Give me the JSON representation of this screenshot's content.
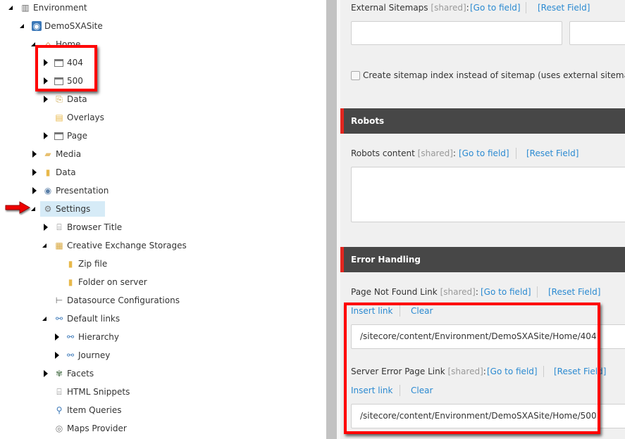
{
  "tree": {
    "items": [
      {
        "label": "Environment",
        "level": 0,
        "state": "expanded",
        "icon": "building-icon"
      },
      {
        "label": "DemoSXASite",
        "level": 1,
        "state": "expanded",
        "icon": "globe-icon"
      },
      {
        "label": "Home",
        "level": 2,
        "state": "expanded",
        "icon": "home-icon"
      },
      {
        "label": "404",
        "level": 3,
        "state": "collapsed",
        "icon": "page-icon"
      },
      {
        "label": "500",
        "level": 3,
        "state": "collapsed",
        "icon": "page-icon"
      },
      {
        "label": "Data",
        "level": 3,
        "state": "collapsed",
        "icon": "data-page-icon"
      },
      {
        "label": "Overlays",
        "level": 3,
        "state": "none",
        "icon": "folder-window-icon"
      },
      {
        "label": "Page",
        "level": 3,
        "state": "collapsed",
        "icon": "page-icon"
      },
      {
        "label": "Media",
        "level": 2,
        "state": "collapsed",
        "icon": "media-folder-icon"
      },
      {
        "label": "Data",
        "level": 2,
        "state": "collapsed",
        "icon": "data-icon"
      },
      {
        "label": "Presentation",
        "level": 2,
        "state": "collapsed",
        "icon": "eye-icon"
      },
      {
        "label": "Settings",
        "level": 2,
        "state": "expanded",
        "icon": "gears-icon",
        "selected": true
      },
      {
        "label": "Browser Title",
        "level": 3,
        "state": "collapsed",
        "icon": "code-page-icon"
      },
      {
        "label": "Creative Exchange Storages",
        "level": 3,
        "state": "expanded",
        "icon": "storage-icon"
      },
      {
        "label": "Zip file",
        "level": 4,
        "state": "none",
        "icon": "zip-icon"
      },
      {
        "label": "Folder on server",
        "level": 4,
        "state": "none",
        "icon": "zip-icon"
      },
      {
        "label": "Datasource Configurations",
        "level": 3,
        "state": "none",
        "icon": "signpost-icon"
      },
      {
        "label": "Default links",
        "level": 3,
        "state": "expanded",
        "icon": "link-icon"
      },
      {
        "label": "Hierarchy",
        "level": 4,
        "state": "collapsed",
        "icon": "link-icon"
      },
      {
        "label": "Journey",
        "level": 4,
        "state": "collapsed",
        "icon": "link-icon"
      },
      {
        "label": "Facets",
        "level": 3,
        "state": "collapsed",
        "icon": "facets-icon"
      },
      {
        "label": "HTML Snippets",
        "level": 3,
        "state": "none",
        "icon": "html-page-icon"
      },
      {
        "label": "Item Queries",
        "level": 3,
        "state": "none",
        "icon": "query-icon"
      },
      {
        "label": "Maps Provider",
        "level": 3,
        "state": "none",
        "icon": "map-icon"
      }
    ]
  },
  "fields": {
    "shared": "[shared]",
    "go_to_field": "[Go to field]",
    "reset_field": "[Reset Field]",
    "insert_link": "Insert link",
    "clear": "Clear",
    "external_sitemaps": {
      "label": "External Sitemaps"
    },
    "sitemap_index": {
      "label": "Create sitemap index instead of sitemap (uses external sitemaps as",
      "checked": false
    },
    "robots_section": "Robots",
    "robots_content": {
      "label": "Robots content"
    },
    "error_section": "Error Handling",
    "page_not_found": {
      "label": "Page Not Found Link",
      "value": "/sitecore/content/Environment/DemoSXASite/Home/404"
    },
    "server_error": {
      "label": "Server Error Page Link",
      "value": "/sitecore/content/Environment/DemoSXASite/Home/500"
    }
  },
  "colors": {
    "accent": "#e2261f",
    "link": "#2b8ad1",
    "header": "#474747",
    "selected": "#d6ebf7",
    "highlight_box": "#ff0000"
  }
}
